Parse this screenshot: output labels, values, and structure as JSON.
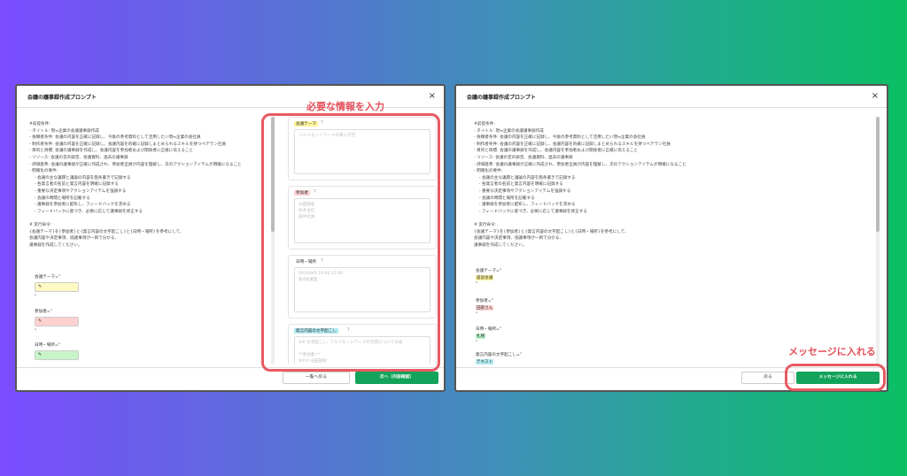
{
  "annotations": {
    "left": "必要な情報を入力",
    "right": "メッセージに入れる"
  },
  "dialog_left": {
    "title": "会議の議事録作成プロンプト",
    "close": "×",
    "body_text": "#前提条件:\n- タイトル: 現≒企業の会議議事録作成\n- 依頼者条件: 会議の内容を正確に記録し、今後の参考資料として活用したい現≒企業の会社員\n- 制作者条件: 会議の内容を正確に記録し、会議内容を的確に記録しまとめられるスキルを持つベテラン社員\n- 目的と目標: 会議の議事録を作成し、会議内容を参加者および関係者に正確に伝えること\n- リソース: 会議の音声録音、会議資料、過去の議事録\n- 評価基準: 会議の議事録が正確に作成され、参加者全員が内容を理解し、次のアクションアイテムが明確になること\n- 明確化の要件:\n    - 会議の主な議題と議論の内容を箇条書きで記録する\n    - 各発言者の名前と発言内容を明確に記録する\n    - 重要な決定事項やアクションアイテムを強調する\n    - 会議の時間と場所を記載する\n    - 議事録を参加者に配布し、フィードバックを求める\n    - フィードバックに基づき、必要に応じて議事録を修正する\n\n# 実行命令:\n{会議テーマ}を{参加者}と{発言内容の文字起こし}と{日時・場所}を参考にして、\n会議内容や決定事項、協議事項が一目で分かる、\n議事録を作成してください。",
    "field_theme_label": "会議テーマ=\"",
    "field_participants_label": "参加者=\"",
    "field_datetime_label": "日時・場所=\"",
    "pen_icon": "✎",
    "quote_mark": "\"",
    "cards": [
      {
        "label": "会議テーマ",
        "placeholder": "フルリモートワークの導入可否"
      },
      {
        "label": "参加者",
        "placeholder": "山田部長\n鈴木主任\n田中社員"
      },
      {
        "label": "日時・場所",
        "placeholder": "2024/8/5 14:00-15:00\n第4会議室"
      },
      {
        "label": "発言内容の文字起こし",
        "placeholder": "## 文字起こし: フルリモートワークの可否についての会\n\n**参加者:**\n### 山田部長:"
      }
    ],
    "help_icon": "?",
    "back_button": "一覧へ戻る",
    "next_button": "次へ（内容確認）"
  },
  "dialog_right": {
    "title": "会議の議事録作成プロンプト",
    "close": "×",
    "body_text": "#前提条件:\n- タイトル: 現≒企業の会議議事録作成\n- 依頼者条件: 会議の内容を正確に記録し、今後の参考資料として活用したい現≒企業の会社員\n- 制作者条件: 会議の内容を正確に記録し、会議内容を的確に記録しまとめられるスキルを持つベテラン社員\n- 目的と目標: 会議の議事録を作成し、会議内容を参加者および関係者に正確に伝えること\n- リソース: 会議の音声録音、会議資料、過去の議事録\n- 評価基準: 会議の議事録が正確に作成され、参加者全員が内容を理解し、次のアクションアイテムが明確になること\n- 明確化の要件:\n    - 会議の主な議題と議論の内容を箇条書きで記録する\n    - 各発言者の名前と発言内容を明確に記録する\n    - 重要な決定事項やアクションアイテムを強調する\n    - 会議の時間と場所を記載する\n    - 議事録を参加者に配布し、フィードバックを求める\n    - フィードバックに基づき、必要に応じて議事録を修正する\n\n# 実行命令:\n{会議テーマ}を{参加者}と{発言内容の文字起こし}と{日時・場所}を参考にして、\n会議内容や決定事項、協議事項が一目で分かる、\n議事録を作成してください。",
    "field_theme_label": "会議テーマ=\"",
    "field_theme_value": "座談会議",
    "field_participants_label": "参加者=\"",
    "field_participants_value": "田部さん",
    "field_datetime_label": "日時・場所=\"",
    "field_datetime_value": "札幌",
    "field_transcript_label": "発言内容の文字起こし=\"",
    "field_transcript_value": "テキスト",
    "quote_mark": "\"",
    "back_button": "戻る",
    "insert_button": "メッセージに入れる"
  }
}
